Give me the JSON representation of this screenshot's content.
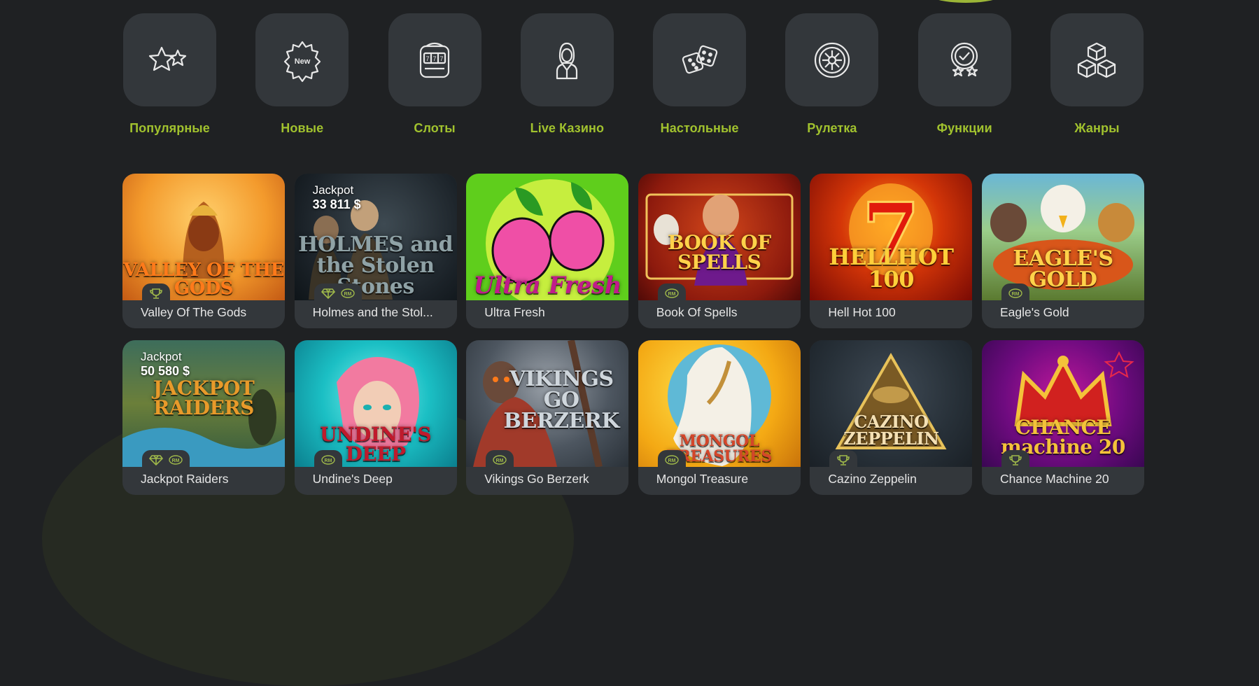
{
  "categories": [
    {
      "label": "Популярные",
      "icon": "stars-icon"
    },
    {
      "label": "Новые",
      "icon": "new-badge-icon"
    },
    {
      "label": "Слоты",
      "icon": "slot-machine-icon"
    },
    {
      "label": "Live Казино",
      "icon": "live-dealer-icon"
    },
    {
      "label": "Настольные",
      "icon": "dice-icon"
    },
    {
      "label": "Рулетка",
      "icon": "roulette-icon"
    },
    {
      "label": "Функции",
      "icon": "award-check-icon"
    },
    {
      "label": "Жанры",
      "icon": "cubes-icon"
    }
  ],
  "games": [
    {
      "name": "Valley Of The Gods",
      "art_text": "VALLEY OF THE GODS",
      "badges": [
        "trophy-icon"
      ],
      "art_color": "#f39a2c"
    },
    {
      "name": "Holmes and the Stol...",
      "art_text": "HOLMES and the Stolen Stones",
      "badges": [
        "diamond-icon",
        "rm-icon"
      ],
      "jackpot_label": "Jackpot",
      "jackpot_amount": "33 811 $",
      "art_color": "#1b2228"
    },
    {
      "name": "Ultra Fresh",
      "art_text": "Ultra Fresh",
      "badges": [],
      "art_color": "#5fce1c"
    },
    {
      "name": "Book Of Spells",
      "art_text": "BOOK OF SPELLS",
      "badges": [
        "rm-icon"
      ],
      "art_color": "#8d1a0d"
    },
    {
      "name": "Hell Hot 100",
      "art_text": "HELLHOT 100",
      "badges": [],
      "art_color": "#d43608"
    },
    {
      "name": "Eagle's Gold",
      "art_text": "EAGLE'S GOLD",
      "badges": [
        "rm-icon"
      ],
      "art_color": "#6ab7d6"
    },
    {
      "name": "Jackpot Raiders",
      "art_text": "JACKPOT RAIDERS",
      "badges": [
        "diamond-icon",
        "rm-icon"
      ],
      "jackpot_label": "Jackpot",
      "jackpot_amount": "50 580 $",
      "art_color": "#6b7f3a"
    },
    {
      "name": "Undine's Deep",
      "art_text": "UNDINE'S DEEP",
      "badges": [
        "rm-icon"
      ],
      "art_color": "#1bbfc4"
    },
    {
      "name": "Vikings Go Berzerk",
      "art_text": "VIKINGS GO BERZERK",
      "badges": [
        "rm-icon"
      ],
      "art_color": "#4d5660"
    },
    {
      "name": "Mongol Treasure",
      "art_text": "MONGOL TREASURES",
      "badges": [
        "rm-icon"
      ],
      "art_color": "#f4a914"
    },
    {
      "name": "Cazino Zeppelin",
      "art_text": "CAZINO ZEPPELIN",
      "badges": [
        "trophy-icon"
      ],
      "art_color": "#273038"
    },
    {
      "name": "Chance Machine 20",
      "art_text": "CHANCE machine 20",
      "badges": [
        "trophy-icon"
      ],
      "art_color": "#6f0b80"
    }
  ],
  "colors": {
    "background": "#1f2123",
    "tile": "#33373b",
    "accent": "#a1c22e",
    "text": "#e6e6e6"
  }
}
